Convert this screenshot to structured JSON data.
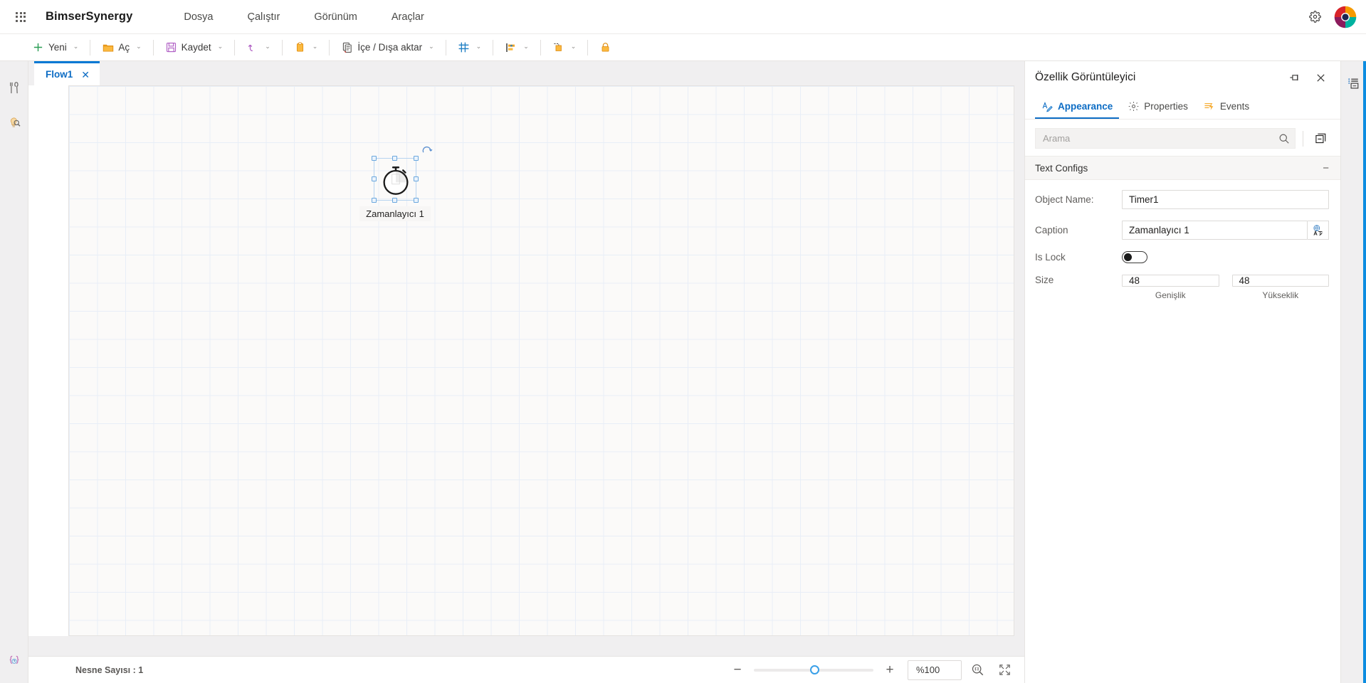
{
  "topbar": {
    "waffle_icon": "app-launcher-icon",
    "brand": "BimserSynergy",
    "menu": [
      {
        "label": "Dosya"
      },
      {
        "label": "Çalıştır"
      },
      {
        "label": "Görünüm"
      },
      {
        "label": "Araçlar"
      }
    ],
    "settings_icon": "gear-icon",
    "avatar_icon": "user-avatar-logo"
  },
  "toolbar": {
    "items": [
      {
        "label": "Yeni",
        "icon": "plus-icon",
        "caret": "⌄"
      },
      {
        "label": "Aç",
        "icon": "folder-open-icon",
        "caret": "⌄"
      },
      {
        "label": "Kaydet",
        "icon": "save-disk-icon",
        "caret": "⌄"
      },
      {
        "label": "",
        "icon": "undo-icon",
        "caret": "⌄"
      },
      {
        "label": "",
        "icon": "clipboard-paste-icon",
        "caret": "⌄"
      },
      {
        "label": "İçe / Dışa aktar",
        "icon": "import-export-icon",
        "caret": "⌄"
      },
      {
        "label": "",
        "icon": "grid-icon",
        "caret": "⌄"
      },
      {
        "label": "",
        "icon": "align-left-icon",
        "caret": "⌄"
      },
      {
        "label": "",
        "icon": "bring-forward-icon",
        "caret": "⌄"
      },
      {
        "label": "",
        "icon": "lock-icon",
        "caret": ""
      }
    ]
  },
  "left_rail": {
    "items": [
      {
        "icon": "tools-icon",
        "name": "toolbox"
      },
      {
        "icon": "lightbulb-search-icon",
        "name": "inspect"
      },
      {
        "icon": "code-braces-icon",
        "name": "script"
      }
    ]
  },
  "tabs": [
    {
      "label": "Flow1",
      "close": "✕",
      "active": true
    }
  ],
  "canvas": {
    "widget": {
      "icon": "stopwatch-timer-icon",
      "caption": "Zamanlayıcı 1",
      "rotate_handle_icon": "rotate-icon"
    }
  },
  "statusbar": {
    "object_count_label": "Nesne Sayısı : 1",
    "zoom_minus": "−",
    "zoom_plus": "+",
    "zoom_value": "%100",
    "zoom_actual_icon": "zoom-actual-size-icon",
    "zoom_fit_icon": "fit-to-screen-icon",
    "slider_position_pct": 47
  },
  "right_panel": {
    "title": "Özellik Görüntüleyici",
    "pin_icon": "pin-icon",
    "close_icon": "close-icon",
    "tabs": [
      {
        "label": "Appearance",
        "icon": "appearance-pen-icon",
        "active": true
      },
      {
        "label": "Properties",
        "icon": "gear-icon",
        "active": false
      },
      {
        "label": "Events",
        "icon": "events-lightning-icon",
        "active": false
      }
    ],
    "search": {
      "placeholder": "Arama",
      "value": "",
      "search_icon": "search-icon"
    },
    "collapse_all_icon": "collapse-all-icon",
    "section": {
      "title": "Text Configs",
      "toggle": "−"
    },
    "fields": {
      "object_name_label": "Object Name:",
      "object_name_value": "Timer1",
      "caption_label": "Caption",
      "caption_value": "Zamanlayıcı 1",
      "caption_addon_icon": "translate-icon",
      "is_lock_label": "Is Lock",
      "is_lock_value": false,
      "size_label": "Size",
      "size_width": "48",
      "size_height": "48",
      "size_width_caption": "Genişlik",
      "size_height_caption": "Yükseklik"
    }
  },
  "right_rail": {
    "items": [
      {
        "icon": "properties-list-icon",
        "name": "properties-panel-toggle"
      }
    ]
  },
  "colors": {
    "accent": "#0c6cc4",
    "panel_bg": "#f0eff0",
    "grid_line": "#e8eef7",
    "canvas_bg": "#fbfaf9"
  }
}
